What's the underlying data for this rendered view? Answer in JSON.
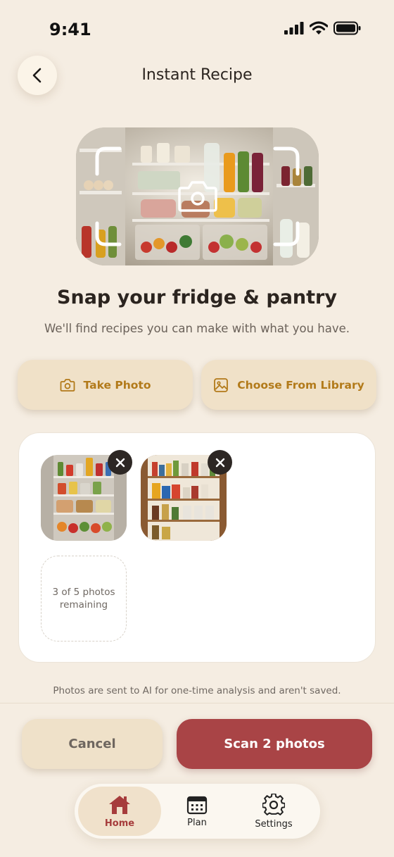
{
  "status_bar": {
    "time": "9:41"
  },
  "header": {
    "title": "Instant Recipe",
    "back_icon": "chevron-left-icon"
  },
  "hero": {
    "image": "fridge-interior-photo",
    "overlay_icon": "camera-icon"
  },
  "intro": {
    "headline": "Snap your fridge & pantry",
    "subhead": "We'll find recipes you can make with what you have."
  },
  "actions": {
    "take_photo": {
      "label": "Take Photo",
      "icon": "camera-icon"
    },
    "choose_library": {
      "label": "Choose From Library",
      "icon": "image-icon"
    }
  },
  "photos": {
    "items": [
      {
        "image": "fridge-photo-thumbnail",
        "remove_icon": "close-icon"
      },
      {
        "image": "pantry-photo-thumbnail",
        "remove_icon": "close-icon"
      }
    ],
    "remaining_text": "3 of 5 photos remaining"
  },
  "privacy_note": "Photos are sent to AI for one-time analysis and aren't saved.",
  "footer": {
    "cancel_label": "Cancel",
    "scan_label": "Scan 2 photos"
  },
  "tabbar": {
    "items": [
      {
        "label": "Home",
        "icon": "home-icon",
        "active": true
      },
      {
        "label": "Plan",
        "icon": "calendar-icon",
        "active": false
      },
      {
        "label": "Settings",
        "icon": "gear-icon",
        "active": false
      }
    ]
  },
  "colors": {
    "background": "#f5ede2",
    "accent": "#a94446",
    "button_tan": "#f0e1c8",
    "gold_text": "#b27a1a"
  }
}
